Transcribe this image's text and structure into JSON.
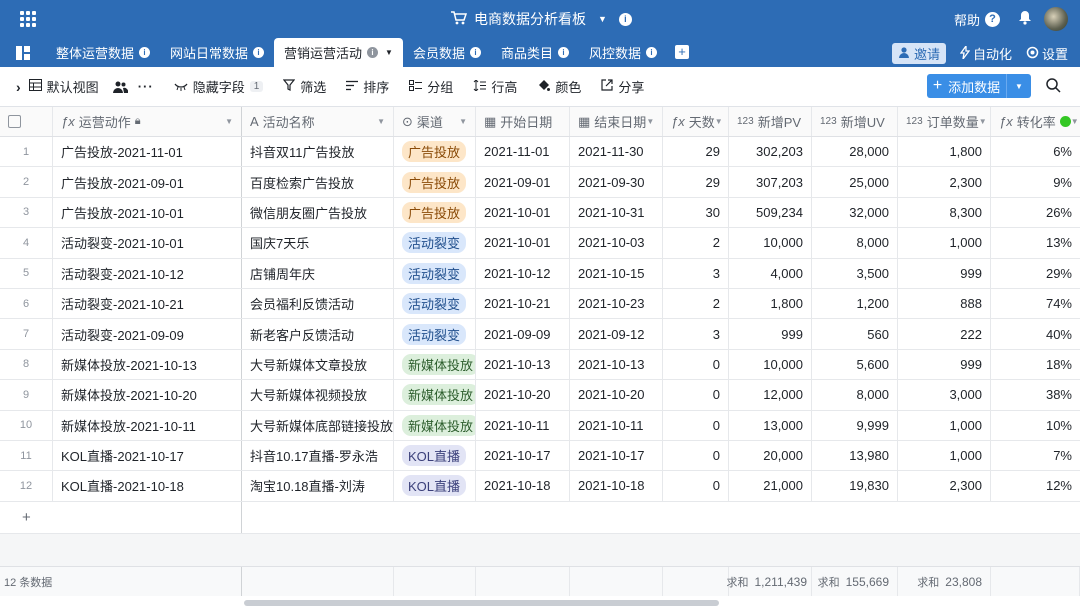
{
  "app": {
    "title": "电商数据分析看板",
    "help": "帮助"
  },
  "tabs": [
    {
      "label": "整体运营数据",
      "active": false
    },
    {
      "label": "网站日常数据",
      "active": false
    },
    {
      "label": "营销运营活动",
      "active": true
    },
    {
      "label": "会员数据",
      "active": false
    },
    {
      "label": "商品类目",
      "active": false
    },
    {
      "label": "风控数据",
      "active": false
    }
  ],
  "tab_actions": {
    "invite": "邀请",
    "automation": "自动化",
    "settings": "设置"
  },
  "toolbar": {
    "view": "默认视图",
    "hidden_fields": "隐藏字段",
    "hidden_count": "1",
    "filter": "筛选",
    "sort": "排序",
    "group": "分组",
    "row_height": "行高",
    "color": "颜色",
    "share": "分享",
    "add_data": "添加数据"
  },
  "columns": [
    {
      "label": "运营动作",
      "icon": "formula-icon"
    },
    {
      "label": "活动名称",
      "icon": "text-icon"
    },
    {
      "label": "渠道",
      "icon": "select-icon"
    },
    {
      "label": "开始日期",
      "icon": "calendar-icon"
    },
    {
      "label": "结束日期",
      "icon": "calendar-icon"
    },
    {
      "label": "天数",
      "icon": "formula-icon"
    },
    {
      "label": "新增PV",
      "icon": "number-icon"
    },
    {
      "label": "新增UV",
      "icon": "number-icon"
    },
    {
      "label": "订单数量",
      "icon": "number-icon"
    },
    {
      "label": "转化率",
      "icon": "formula-icon"
    }
  ],
  "channel_colors": {
    "广告投放": {
      "bg": "#fde6c8",
      "fg": "#8a4b08"
    },
    "活动裂变": {
      "bg": "#d9e7fb",
      "fg": "#1f4e8c"
    },
    "新媒体投放": {
      "bg": "#dcefdc",
      "fg": "#2c5d2c"
    },
    "KOL直播": {
      "bg": "#e2e4f5",
      "fg": "#3a3f7a"
    }
  },
  "rows": [
    {
      "n": "1",
      "action": "广告投放-2021-11-01",
      "name": "抖音双11广告投放",
      "channel": "广告投放",
      "start": "2021-11-01",
      "end": "2021-11-30",
      "days": "29",
      "pv": "302,203",
      "uv": "28,000",
      "orders": "1,800",
      "rate": "6%"
    },
    {
      "n": "2",
      "action": "广告投放-2021-09-01",
      "name": "百度检索广告投放",
      "channel": "广告投放",
      "start": "2021-09-01",
      "end": "2021-09-30",
      "days": "29",
      "pv": "307,203",
      "uv": "25,000",
      "orders": "2,300",
      "rate": "9%"
    },
    {
      "n": "3",
      "action": "广告投放-2021-10-01",
      "name": "微信朋友圈广告投放",
      "channel": "广告投放",
      "start": "2021-10-01",
      "end": "2021-10-31",
      "days": "30",
      "pv": "509,234",
      "uv": "32,000",
      "orders": "8,300",
      "rate": "26%"
    },
    {
      "n": "4",
      "action": "活动裂变-2021-10-01",
      "name": "国庆7天乐",
      "channel": "活动裂变",
      "start": "2021-10-01",
      "end": "2021-10-03",
      "days": "2",
      "pv": "10,000",
      "uv": "8,000",
      "orders": "1,000",
      "rate": "13%"
    },
    {
      "n": "5",
      "action": "活动裂变-2021-10-12",
      "name": "店铺周年庆",
      "channel": "活动裂变",
      "start": "2021-10-12",
      "end": "2021-10-15",
      "days": "3",
      "pv": "4,000",
      "uv": "3,500",
      "orders": "999",
      "rate": "29%"
    },
    {
      "n": "6",
      "action": "活动裂变-2021-10-21",
      "name": "会员福利反馈活动",
      "channel": "活动裂变",
      "start": "2021-10-21",
      "end": "2021-10-23",
      "days": "2",
      "pv": "1,800",
      "uv": "1,200",
      "orders": "888",
      "rate": "74%"
    },
    {
      "n": "7",
      "action": "活动裂变-2021-09-09",
      "name": "新老客户反馈活动",
      "channel": "活动裂变",
      "start": "2021-09-09",
      "end": "2021-09-12",
      "days": "3",
      "pv": "999",
      "uv": "560",
      "orders": "222",
      "rate": "40%"
    },
    {
      "n": "8",
      "action": "新媒体投放-2021-10-13",
      "name": "大号新媒体文章投放",
      "channel": "新媒体投放",
      "start": "2021-10-13",
      "end": "2021-10-13",
      "days": "0",
      "pv": "10,000",
      "uv": "5,600",
      "orders": "999",
      "rate": "18%"
    },
    {
      "n": "9",
      "action": "新媒体投放-2021-10-20",
      "name": "大号新媒体视频投放",
      "channel": "新媒体投放",
      "start": "2021-10-20",
      "end": "2021-10-20",
      "days": "0",
      "pv": "12,000",
      "uv": "8,000",
      "orders": "3,000",
      "rate": "38%"
    },
    {
      "n": "10",
      "action": "新媒体投放-2021-10-11",
      "name": "大号新媒体底部链接投放",
      "channel": "新媒体投放",
      "start": "2021-10-11",
      "end": "2021-10-11",
      "days": "0",
      "pv": "13,000",
      "uv": "9,999",
      "orders": "1,000",
      "rate": "10%"
    },
    {
      "n": "11",
      "action": "KOL直播-2021-10-17",
      "name": "抖音10.17直播-罗永浩",
      "channel": "KOL直播",
      "start": "2021-10-17",
      "end": "2021-10-17",
      "days": "0",
      "pv": "20,000",
      "uv": "13,980",
      "orders": "1,000",
      "rate": "7%"
    },
    {
      "n": "12",
      "action": "KOL直播-2021-10-18",
      "name": "淘宝10.18直播-刘涛",
      "channel": "KOL直播",
      "start": "2021-10-18",
      "end": "2021-10-18",
      "days": "0",
      "pv": "21,000",
      "uv": "19,830",
      "orders": "2,300",
      "rate": "12%"
    }
  ],
  "footer": {
    "count": "12 条数据",
    "sum_label": "求和",
    "pv_sum": "1,211,439",
    "uv_sum": "155,669",
    "orders_sum": "23,808"
  }
}
